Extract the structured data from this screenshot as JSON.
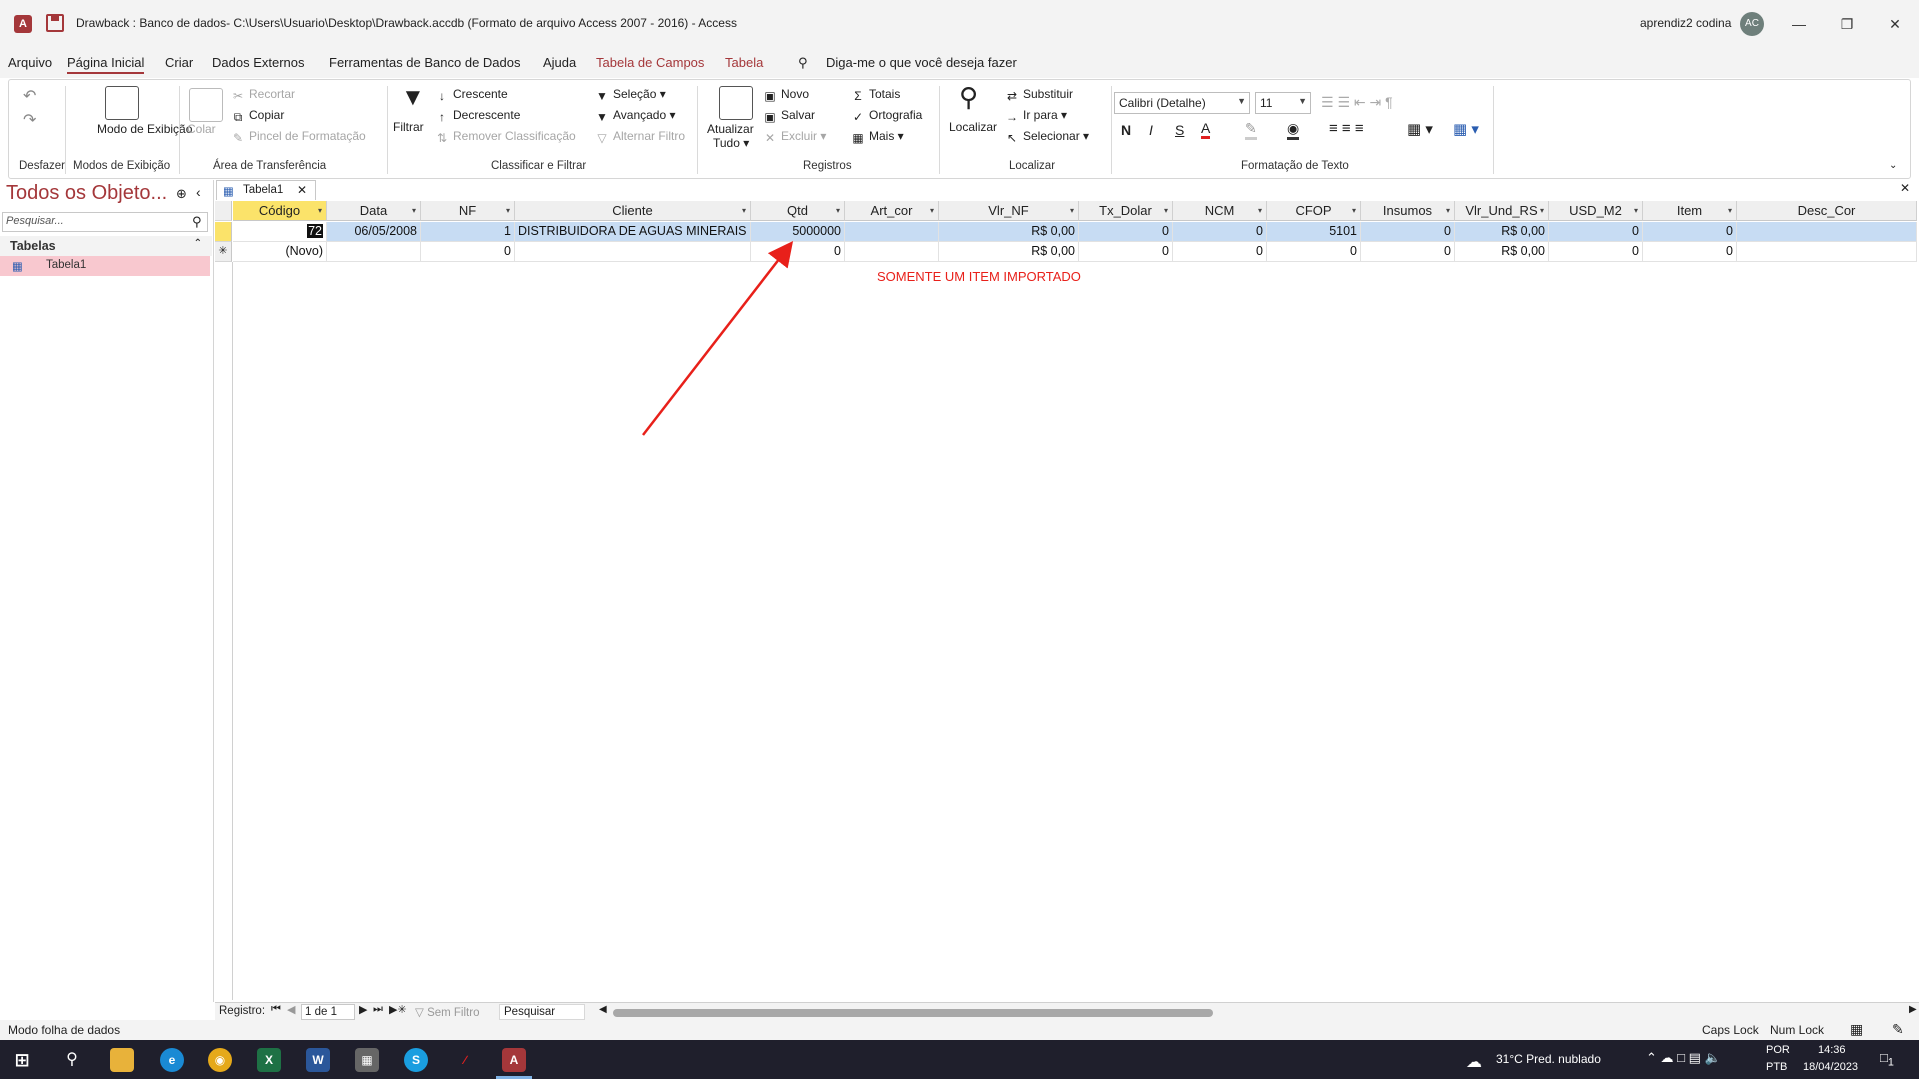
{
  "window": {
    "title": "Drawback : Banco de dados- C:\\Users\\Usuario\\Desktop\\Drawback.accdb (Formato de arquivo Access 2007 - 2016)  -  Access",
    "user_name": "aprendiz2 codina",
    "user_initials": "AC",
    "app_icon_letter": "A"
  },
  "menu": {
    "items": [
      "Arquivo",
      "Página Inicial",
      "Criar",
      "Dados Externos",
      "Ferramentas de Banco de Dados",
      "Ajuda",
      "Tabela de Campos",
      "Tabela"
    ],
    "active_index": 1,
    "tell_me": "Diga-me o que você deseja fazer"
  },
  "ribbon": {
    "undo_group": "Desfazer",
    "views": {
      "button": "Modo de Exibição",
      "group": "Modos de Exibição"
    },
    "clipboard": {
      "paste": "Colar",
      "cut": "Recortar",
      "copy": "Copiar",
      "format_painter": "Pincel de Formatação",
      "group": "Área de Transferência"
    },
    "sort_filter": {
      "filter": "Filtrar",
      "ascending": "Crescente",
      "descending": "Decrescente",
      "remove_sort": "Remover Classificação",
      "selection": "Seleção",
      "advanced": "Avançado",
      "toggle_filter": "Alternar Filtro",
      "group": "Classificar e Filtrar"
    },
    "records": {
      "refresh_all_line1": "Atualizar",
      "refresh_all_line2": "Tudo",
      "new": "Novo",
      "save": "Salvar",
      "delete": "Excluir",
      "totals": "Totais",
      "spelling": "Ortografia",
      "more": "Mais",
      "group": "Registros"
    },
    "find": {
      "find": "Localizar",
      "replace": "Substituir",
      "goto": "Ir para",
      "select": "Selecionar",
      "group": "Localizar"
    },
    "text_format": {
      "font": "Calibri (Detalhe)",
      "size": "11",
      "bold": "N",
      "italic": "I",
      "underline": "S",
      "group": "Formatação de Texto"
    }
  },
  "nav": {
    "title": "Todos os Objeto...",
    "search_placeholder": "Pesquisar...",
    "section": "Tabelas",
    "items": [
      "Tabela1"
    ]
  },
  "doc_tab": "Tabela1",
  "table": {
    "columns": [
      "Código",
      "Data",
      "NF",
      "Cliente",
      "Qtd",
      "Art_cor",
      "Vlr_NF",
      "Tx_Dolar",
      "NCM",
      "CFOP",
      "Insumos",
      "Vlr_Und_RS",
      "USD_M2",
      "Item",
      "Desc_Cor"
    ],
    "rows": [
      [
        "72",
        "06/05/2008",
        "1",
        "DISTRIBUIDORA DE AGUAS MINERAIS",
        "5000000",
        "",
        "R$ 0,00",
        "0",
        "0",
        "5101",
        "0",
        "R$ 0,00",
        "0",
        "0",
        ""
      ],
      [
        "(Novo)",
        "",
        "0",
        "",
        "0",
        "",
        "R$ 0,00",
        "0",
        "0",
        "0",
        "0",
        "R$ 0,00",
        "0",
        "0",
        ""
      ]
    ]
  },
  "annotation": "SOMENTE UM ITEM IMPORTADO",
  "record_nav": {
    "label": "Registro:",
    "position": "1 de 1",
    "filter": "Sem Filtro",
    "search": "Pesquisar"
  },
  "status": {
    "mode": "Modo folha de dados",
    "caps": "Caps Lock",
    "num": "Num Lock"
  },
  "taskbar": {
    "weather": "31°C  Pred. nublado",
    "lang1": "POR",
    "lang2": "PTB",
    "time": "14:36",
    "date": "18/04/2023",
    "notifications": "1"
  },
  "colors": {
    "accent": "#a4373a",
    "selected_row": "#c7dcf3",
    "selected_header": "#fbe36a",
    "annotation": "#e8201a"
  }
}
